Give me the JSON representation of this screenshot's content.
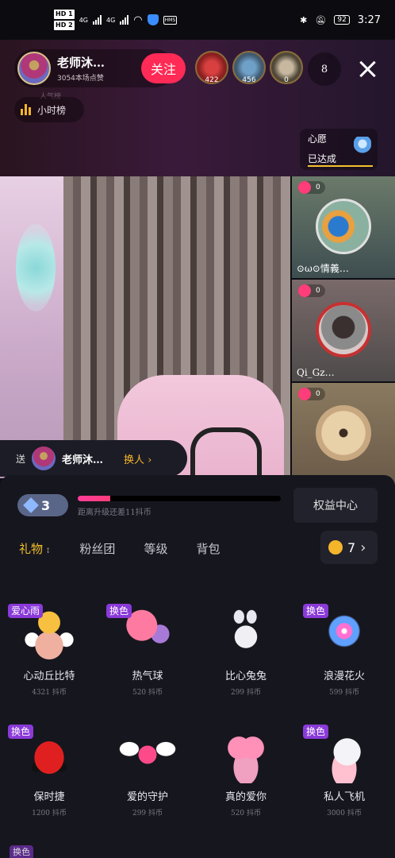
{
  "status_bar": {
    "hd1": "HD 1",
    "hd2": "HD 2",
    "net1": "4G",
    "net2": "4G",
    "hms": "HMS",
    "battery": "92",
    "time": "3:27"
  },
  "host": {
    "name": "老师沐…",
    "subtitle": "3054本场点赞",
    "follow_label": "关注"
  },
  "viewers": [
    {
      "count": "422"
    },
    {
      "count": "456"
    },
    {
      "count": "0"
    }
  ],
  "viewer_total": "8",
  "rank": {
    "label": "小时榜",
    "top_text": "人气榜"
  },
  "wish": {
    "line1": "心愿",
    "line2": "已达成"
  },
  "mics": [
    {
      "badge": "0",
      "name": "⊙ω⊙情義…"
    },
    {
      "badge": "0",
      "name": "Qi_Gz…"
    },
    {
      "badge": "0",
      "name": ""
    }
  ],
  "send_to": {
    "label": "送",
    "name": "老师沐…",
    "switch_label": "换人 ›"
  },
  "level": {
    "value": "3",
    "progress": 0.16,
    "progress_text": "距离升级还差11抖币"
  },
  "benefit_label": "权益中心",
  "tabs": [
    "礼物",
    "粉丝团",
    "等级",
    "背包"
  ],
  "coin": {
    "balance": "7",
    "chevron": "›"
  },
  "gifts": [
    {
      "tag": "爱心雨",
      "name": "心动丘比特",
      "price": "4321 抖币",
      "icon": "cupid-icon"
    },
    {
      "tag": "换色",
      "name": "热气球",
      "price": "520 抖币",
      "icon": "hot-air-balloon-icon"
    },
    {
      "tag": "",
      "name": "比心兔兔",
      "price": "299 抖币",
      "icon": "rabbit-icon"
    },
    {
      "tag": "换色",
      "name": "浪漫花火",
      "price": "599 抖币",
      "icon": "firework-icon"
    },
    {
      "tag": "换色",
      "name": "保时捷",
      "price": "1200 抖币",
      "icon": "sports-car-icon"
    },
    {
      "tag": "",
      "name": "爱的守护",
      "price": "299 抖币",
      "icon": "love-wings-icon"
    },
    {
      "tag": "",
      "name": "真的爱你",
      "price": "520 抖币",
      "icon": "heart-love-icon"
    },
    {
      "tag": "换色",
      "name": "私人飞机",
      "price": "3000 抖币",
      "icon": "private-jet-icon"
    }
  ],
  "peek_tag": "换色"
}
